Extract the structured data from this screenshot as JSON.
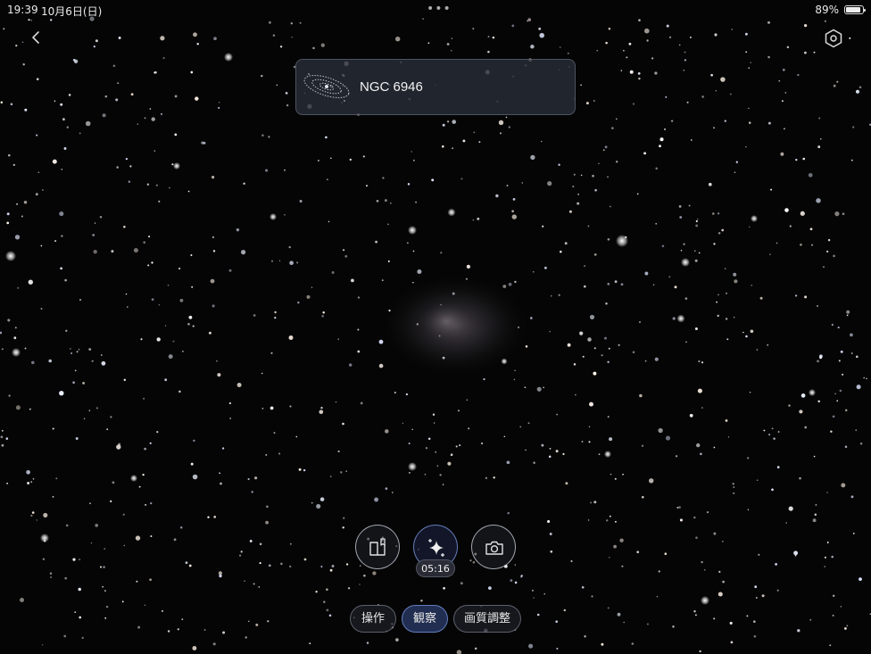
{
  "status_bar": {
    "time": "19:39",
    "date": "10月6日(日)",
    "dots": "•••",
    "battery_percent": "89%",
    "battery_level": 0.89
  },
  "header": {
    "back_icon": "chevron-left-icon",
    "settings_icon": "hexagon-settings-icon"
  },
  "target": {
    "name": "NGC 6946",
    "thumbnail_icon": "galaxy-thumbnail-icon"
  },
  "controls": {
    "buttons": [
      {
        "id": "book",
        "icon": "book-icon"
      },
      {
        "id": "enhance",
        "icon": "sparkle-icon"
      },
      {
        "id": "capture",
        "icon": "camera-icon"
      }
    ],
    "timer": "05:16"
  },
  "tabs": [
    {
      "label": "操作",
      "active": false
    },
    {
      "label": "観察",
      "active": true
    },
    {
      "label": "画質調整",
      "active": false
    }
  ],
  "colors": {
    "background": "#040404",
    "accent": "#2a3a6e",
    "card_bg": "#282d38"
  }
}
